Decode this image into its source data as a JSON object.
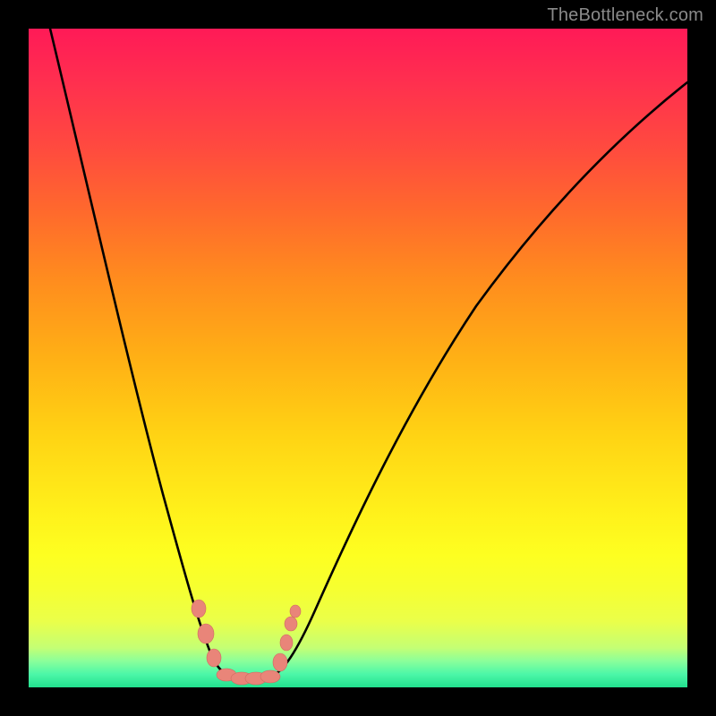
{
  "watermark": {
    "text": "TheBottleneck.com"
  },
  "plot": {
    "inner_left": 32,
    "inner_top": 32,
    "inner_width": 736,
    "inner_height": 736,
    "gradient_colors": {
      "top": "#ff1a57",
      "mid_upper": "#ff8c1e",
      "mid": "#fff21b",
      "low": "#c4ff74",
      "bottom": "#22e08e"
    }
  },
  "chart_data": {
    "type": "line",
    "title": "",
    "xlabel": "",
    "ylabel": "",
    "xlim": [
      0,
      100
    ],
    "ylim": [
      0,
      100
    ],
    "grid": false,
    "legend": false,
    "annotations": [
      "TheBottleneck.com"
    ],
    "series": [
      {
        "name": "bottleneck-curve",
        "color": "#000000",
        "x": [
          3,
          6,
          10,
          14,
          18,
          22,
          25,
          27,
          28.6,
          30,
          32,
          34,
          36,
          38,
          40,
          45,
          53,
          63,
          75,
          88,
          100
        ],
        "values": [
          100,
          86,
          72,
          58,
          44,
          30,
          16,
          6,
          0,
          0,
          0,
          0,
          0,
          6,
          12,
          24,
          40,
          56,
          70,
          82,
          92
        ]
      },
      {
        "name": "trough-dots",
        "color": "#e98579",
        "type": "scatter",
        "x": [
          25.2,
          26.3,
          27.5,
          29.0,
          30.5,
          32.0,
          33.3,
          34.6,
          36.0,
          36.8,
          37.8
        ],
        "values": [
          12.0,
          8.0,
          3.0,
          0.5,
          0.3,
          0.3,
          0.5,
          0.8,
          5.0,
          9.0,
          11.0
        ]
      }
    ]
  }
}
